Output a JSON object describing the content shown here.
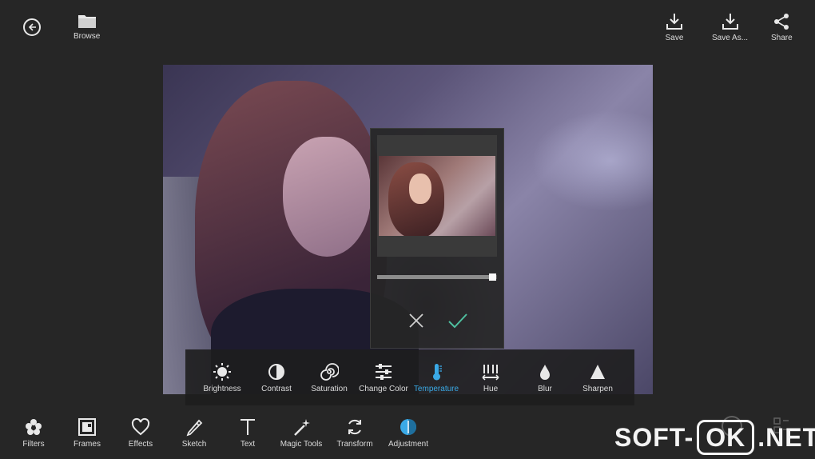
{
  "topbar": {
    "browse_label": "Browse",
    "save_label": "Save",
    "save_as_label": "Save As...",
    "share_label": "Share"
  },
  "adjustment_toolbar": {
    "items": [
      {
        "label": "Brightness",
        "icon": "sun-icon"
      },
      {
        "label": "Contrast",
        "icon": "contrast-icon"
      },
      {
        "label": "Saturation",
        "icon": "swirl-icon"
      },
      {
        "label": "Change Color",
        "icon": "sliders-icon"
      },
      {
        "label": "Temperature",
        "icon": "thermometer-icon",
        "active": true
      },
      {
        "label": "Hue",
        "icon": "hue-bars-icon"
      },
      {
        "label": "Blur",
        "icon": "drop-icon"
      },
      {
        "label": "Sharpen",
        "icon": "triangle-icon"
      }
    ],
    "active_color": "#3aa9e6"
  },
  "tools": {
    "items": [
      {
        "label": "Filters",
        "icon": "flower-icon"
      },
      {
        "label": "Frames",
        "icon": "frame-icon"
      },
      {
        "label": "Effects",
        "icon": "heart-icon"
      },
      {
        "label": "Sketch",
        "icon": "pencil-icon"
      },
      {
        "label": "Text",
        "icon": "text-icon"
      },
      {
        "label": "Magic Tools",
        "icon": "magic-wand-icon"
      },
      {
        "label": "Transform",
        "icon": "transform-icon"
      },
      {
        "label": "Adjustment",
        "icon": "adjustment-icon",
        "active": true
      }
    ]
  },
  "popup": {
    "slider_value": 0.97
  },
  "watermark": {
    "left": "SOFT-",
    "boxed": "OK",
    "right": ".NET"
  },
  "colors": {
    "background": "#262626",
    "accent": "#3aa9e6",
    "confirm": "#4fc0a0"
  }
}
